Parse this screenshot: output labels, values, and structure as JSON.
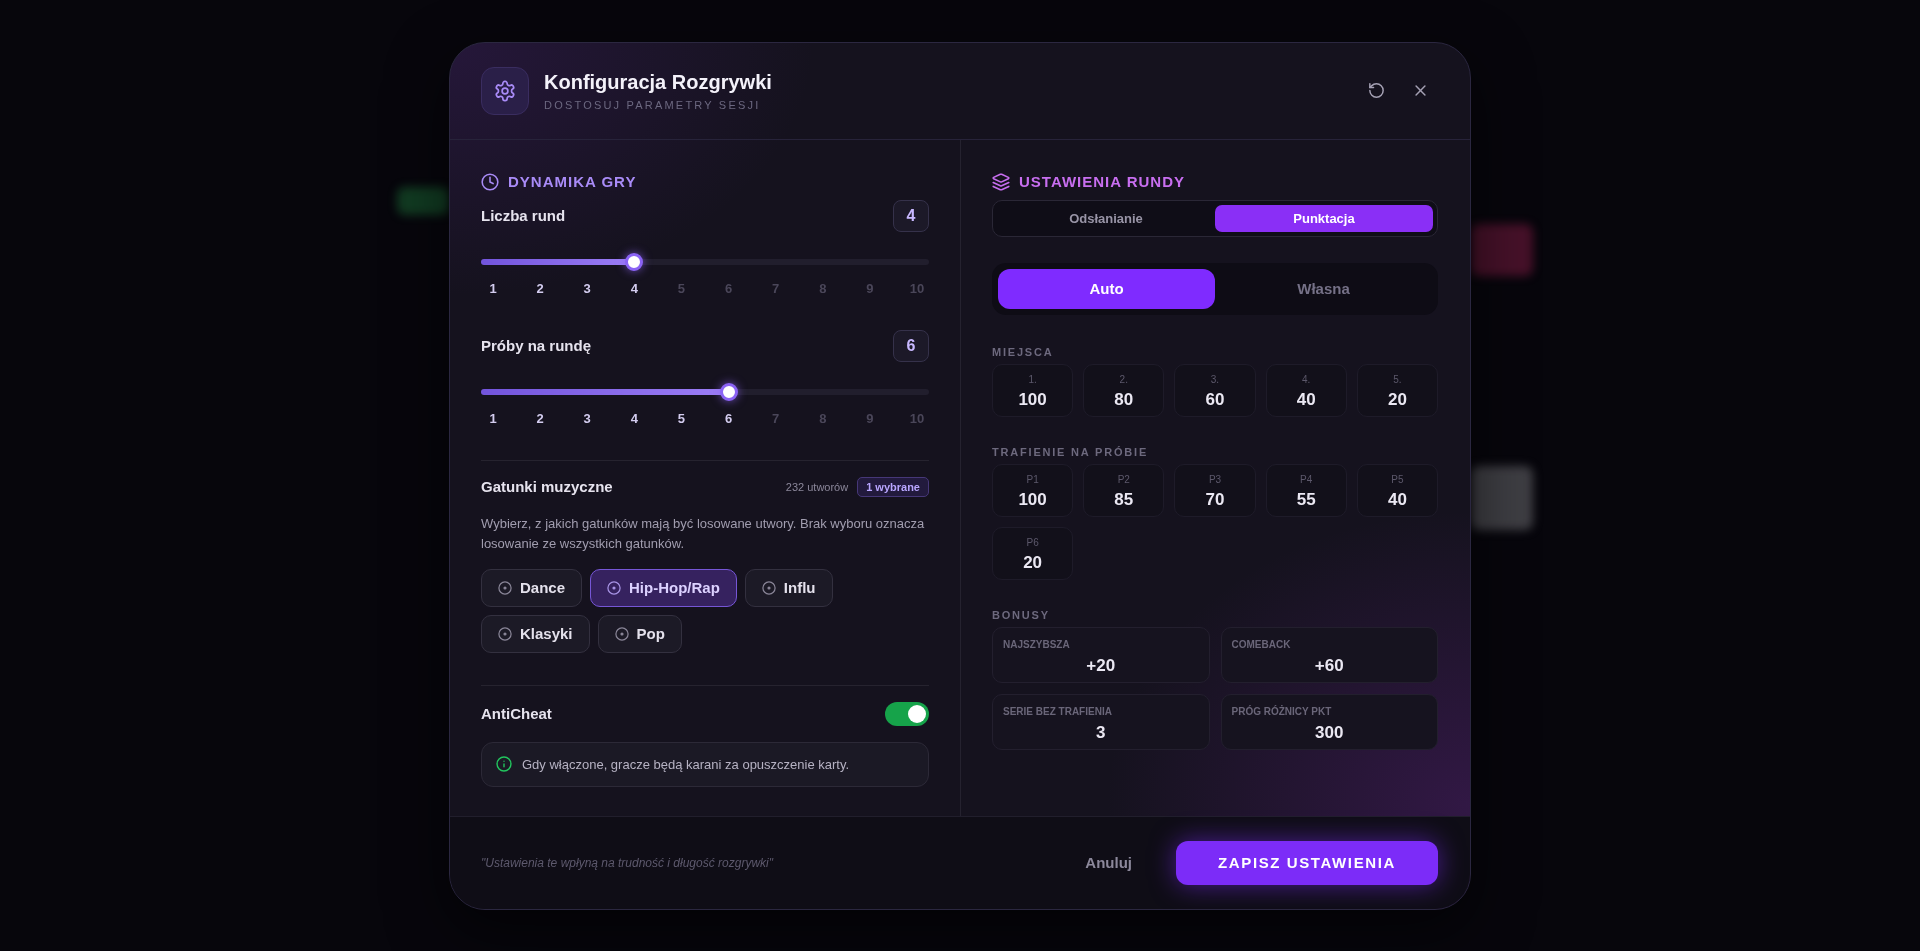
{
  "dialog": {
    "title": "Konfiguracja Rozgrywki",
    "subtitle": "DOSTOSUJ PARAMETRY SESJI"
  },
  "left_panel": {
    "heading": "DYNAMIKA GRY",
    "sliders": [
      {
        "label": "Liczba rund",
        "value": "4",
        "level": 0.333,
        "ticks": [
          {
            "label": "1",
            "active": true
          },
          {
            "label": "2",
            "active": true
          },
          {
            "label": "3",
            "active": true
          },
          {
            "label": "4",
            "active": true
          },
          {
            "label": "5",
            "active": false
          },
          {
            "label": "6",
            "active": false
          },
          {
            "label": "7",
            "active": false
          },
          {
            "label": "8",
            "active": false
          },
          {
            "label": "9",
            "active": false
          },
          {
            "label": "10",
            "active": false
          }
        ]
      },
      {
        "label": "Próby na rundę",
        "value": "6",
        "level": 0.556,
        "ticks": [
          {
            "label": "1",
            "active": true
          },
          {
            "label": "2",
            "active": true
          },
          {
            "label": "3",
            "active": true
          },
          {
            "label": "4",
            "active": true
          },
          {
            "label": "5",
            "active": true
          },
          {
            "label": "6",
            "active": true
          },
          {
            "label": "7",
            "active": false
          },
          {
            "label": "8",
            "active": false
          },
          {
            "label": "9",
            "active": false
          },
          {
            "label": "10",
            "active": false
          }
        ]
      }
    ],
    "genres": {
      "title": "Gatunki muzyczne",
      "track_count": "232 utworów",
      "selected_count": "1 wybrane",
      "description": "Wybierz, z jakich gatunków mają być losowane utwory. Brak wyboru oznacza losowanie ze wszystkich gatunków.",
      "chips": [
        {
          "label": "Dance",
          "selected": false
        },
        {
          "label": "Hip-Hop/Rap",
          "selected": true
        },
        {
          "label": "Influ",
          "selected": false
        },
        {
          "label": "Klasyki",
          "selected": false
        },
        {
          "label": "Pop",
          "selected": false
        }
      ]
    },
    "anticheat": {
      "label": "AntiCheat",
      "on": true,
      "info": "Gdy włączone, gracze będą karani za opuszczenie karty."
    }
  },
  "right_panel": {
    "heading": "USTAWIENIA RUNDY",
    "tabs": [
      {
        "label": "Odsłanianie",
        "selected": false
      },
      {
        "label": "Punktacja",
        "selected": true
      }
    ],
    "modes": [
      {
        "label": "Auto",
        "selected": true
      },
      {
        "label": "Własna",
        "selected": false
      }
    ],
    "places": {
      "title": "MIEJSCA",
      "items": [
        {
          "label": "1.",
          "value": "100"
        },
        {
          "label": "2.",
          "value": "80"
        },
        {
          "label": "3.",
          "value": "60"
        },
        {
          "label": "4.",
          "value": "40"
        },
        {
          "label": "5.",
          "value": "20"
        }
      ]
    },
    "attempt_hits": {
      "title": "TRAFIENIE NA PRÓBIE",
      "items": [
        {
          "label": "P1",
          "value": "100"
        },
        {
          "label": "P2",
          "value": "85"
        },
        {
          "label": "P3",
          "value": "70"
        },
        {
          "label": "P4",
          "value": "55"
        },
        {
          "label": "P5",
          "value": "40"
        },
        {
          "label": "P6",
          "value": "20"
        }
      ]
    },
    "bonuses": {
      "title": "BONUSY",
      "items": [
        {
          "label": "NAJSZYBSZA",
          "value": "+20"
        },
        {
          "label": "COMEBACK",
          "value": "+60"
        },
        {
          "label": "SERIE BEZ TRAFIENIA",
          "value": "3"
        },
        {
          "label": "PRÓG RÓŻNICY PKT",
          "value": "300"
        }
      ]
    }
  },
  "footer": {
    "note": "\"Ustawienia te wpłyną na trudność i długość rozgrywki\"",
    "cancel": "Anuluj",
    "save": "ZAPISZ USTAWIENIA"
  }
}
